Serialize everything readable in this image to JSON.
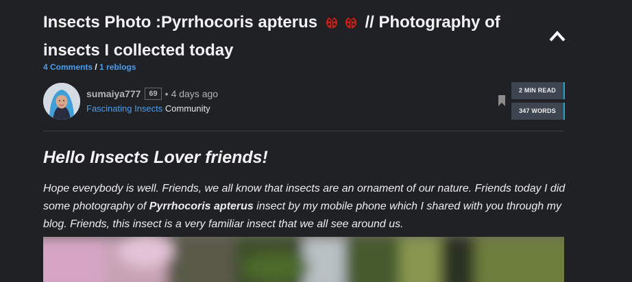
{
  "post": {
    "title_part1": "Insects Photo :Pyrrhocoris apterus",
    "title_part2": " // Photography of insects I collected today",
    "bug_icons": [
      "ladybug-icon",
      "ladybug-icon"
    ],
    "comments_label": "4 Comments",
    "slash": " / ",
    "reblogs_label": "1 reblogs"
  },
  "author": {
    "name": "sumaiya777",
    "reputation": "69",
    "bullet": "•",
    "time_ago": "4 days ago",
    "community_name": "Fascinating Insects",
    "community_suffix": " Community"
  },
  "stats": {
    "read_time": "2 MIN READ",
    "word_count": "347 WORDS"
  },
  "body": {
    "heading": "Hello Insects Lover friends!",
    "para_before": "Hope everybody is well. Friends, we all know that insects are an ornament of our nature. Friends today I did some photography of ",
    "para_bold": "Pyrrhocoris apterus",
    "para_after": " insect by my mobile phone which I shared with you through my blog. Friends, this insect is a very familiar insect that we all see around us."
  },
  "colors": {
    "background": "#1f2124",
    "link": "#4b9df0",
    "stat_bg": "#3c4550",
    "stat_accent": "#27a5c8"
  }
}
